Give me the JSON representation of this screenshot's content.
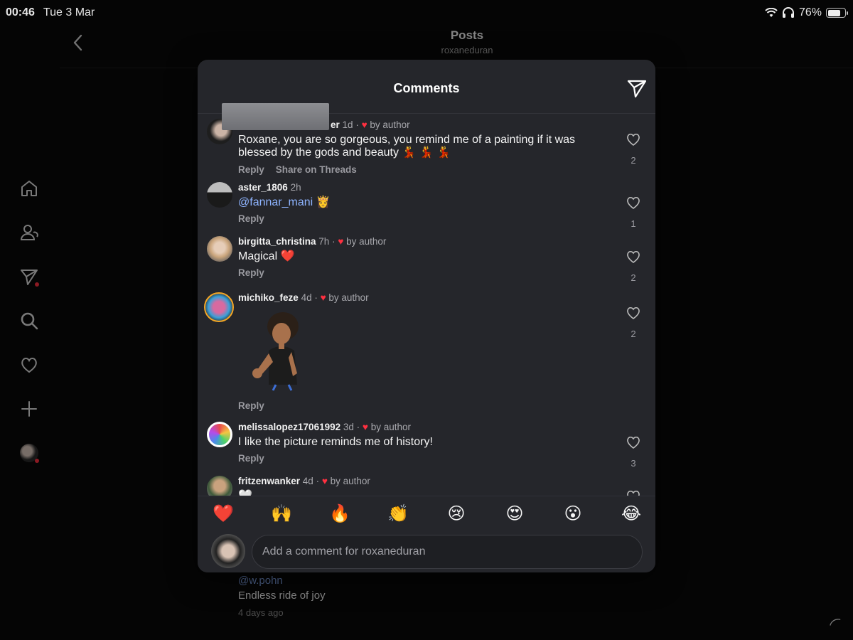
{
  "status_bar": {
    "time": "00:46",
    "date": "Tue 3 Mar",
    "battery": "76%"
  },
  "background_page": {
    "title": "Posts",
    "subtitle": "roxaneduran",
    "comment": {
      "mention": "@w.pohn",
      "text": "Endless ride of joy",
      "time": "4 days ago"
    }
  },
  "sidebar": {
    "items": [
      "home-icon",
      "profile-icon",
      "send-icon",
      "search-icon",
      "heart-icon",
      "add-icon",
      "profile-avatar"
    ]
  },
  "modal": {
    "title": "Comments",
    "comments": [
      {
        "username": "er",
        "time": "1d",
        "by_author": "by author",
        "text": "Roxane, you are so gorgeous, you remind me of a painting if it was blessed by the gods and beauty 💃 💃 💃",
        "actions": [
          "Reply",
          "Share on Threads"
        ],
        "likes": "2"
      },
      {
        "username": "aster_1806",
        "time": "2h",
        "mention": "@fannar_mani",
        "text": "👸",
        "actions": [
          "Reply"
        ],
        "likes": "1"
      },
      {
        "username": "birgitta_christina",
        "time": "7h",
        "by_author": "by author",
        "text": "Magical ❤️",
        "actions": [
          "Reply"
        ],
        "likes": "2"
      },
      {
        "username": "michiko_feze",
        "time": "4d",
        "by_author": "by author",
        "sticker": "avatar-sticker",
        "actions": [
          "Reply"
        ],
        "likes": "2"
      },
      {
        "username": "melissalopez17061992",
        "time": "3d",
        "by_author": "by author",
        "text": "I like the picture reminds me of history!",
        "actions": [
          "Reply"
        ],
        "likes": "3"
      },
      {
        "username": "fritzenwanker",
        "time": "4d",
        "by_author": "by author",
        "text": "🤍"
      }
    ],
    "reactions": [
      "❤️",
      "🙌",
      "🔥",
      "👏",
      "😢",
      "😍",
      "😮",
      "😂"
    ],
    "composer": {
      "placeholder": "Add a comment for roxaneduran"
    }
  },
  "colors": {
    "modal_bg": "#25262b",
    "accent_heart": "#ff3040",
    "mention": "#8eb4ff"
  }
}
